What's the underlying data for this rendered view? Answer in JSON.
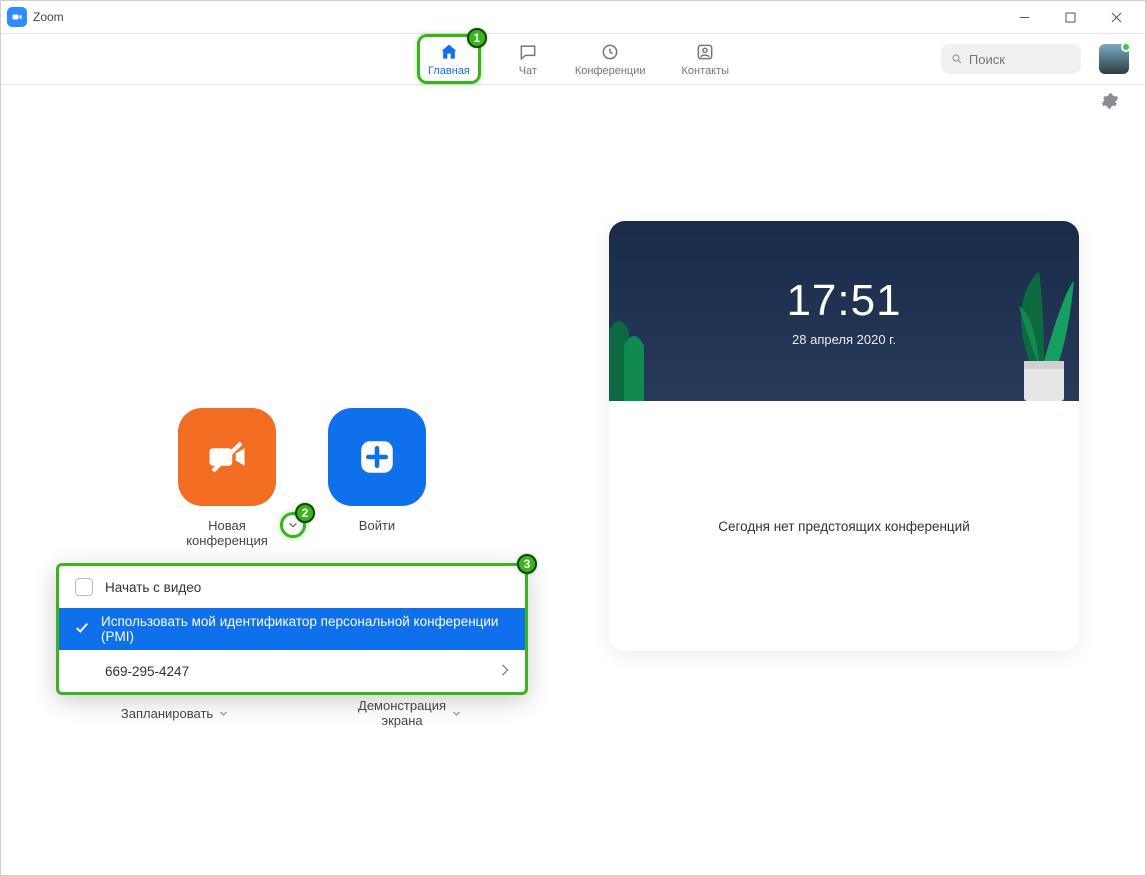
{
  "app": {
    "title": "Zoom"
  },
  "nav": {
    "home": "Главная",
    "chat": "Чат",
    "meetings": "Конференции",
    "contacts": "Контакты"
  },
  "search": {
    "placeholder": "Поиск"
  },
  "tiles": {
    "new_meeting": "Новая\nконференция",
    "join": "Войти",
    "schedule": "Запланировать",
    "share": "Демонстрация\nэкрана"
  },
  "dropdown": {
    "start_video": "Начать с видео",
    "use_pmi": "Использовать мой идентификатор персональной конференции (PMI)",
    "pmi": "669-295-4247"
  },
  "clock": {
    "time": "17:51",
    "date": "28 апреля 2020 г.",
    "empty": "Сегодня нет предстоящих конференций"
  },
  "badges": {
    "b1": "1",
    "b2": "2",
    "b3": "3"
  }
}
